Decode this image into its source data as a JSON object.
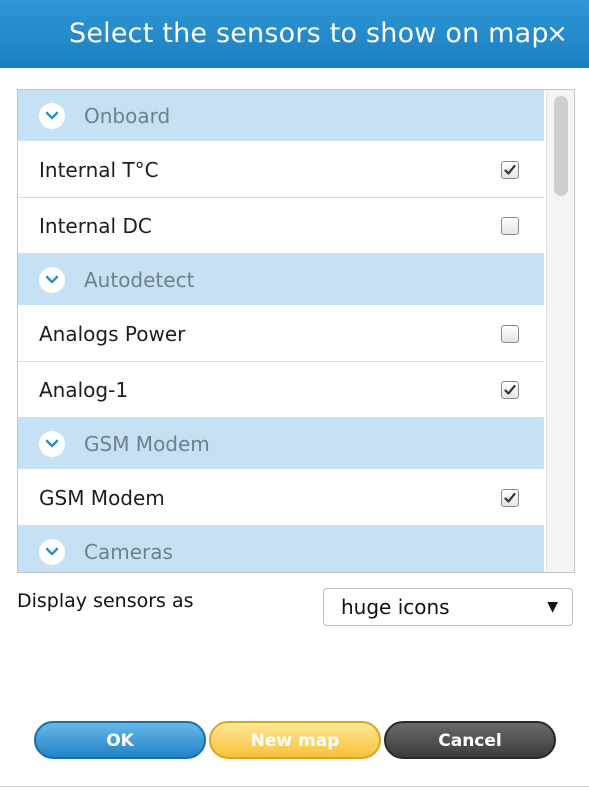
{
  "dialog": {
    "title": "Select the sensors to show on map",
    "close_glyph": "×"
  },
  "colors": {
    "header": "#1f87c9",
    "group_row": "#c6e1f3",
    "ok_button": "#2a8bcf",
    "new_map_button": "#f7c23a",
    "cancel_button": "#444444"
  },
  "list": {
    "groups": [
      {
        "label": "Onboard",
        "icon": "chevron-down-circle-icon",
        "items": [
          {
            "label": "Internal T°C",
            "checked": true
          },
          {
            "label": "Internal DC",
            "checked": false
          }
        ]
      },
      {
        "label": "Autodetect",
        "icon": "chevron-down-circle-icon",
        "items": [
          {
            "label": "Analogs Power",
            "checked": false
          },
          {
            "label": "Analog-1",
            "checked": true
          }
        ]
      },
      {
        "label": "GSM Modem",
        "icon": "chevron-down-circle-icon",
        "items": [
          {
            "label": "GSM Modem",
            "checked": true
          }
        ]
      },
      {
        "label": "Cameras",
        "icon": "chevron-down-circle-icon",
        "items": []
      }
    ]
  },
  "display": {
    "label": "Display sensors as",
    "selected": "huge icons",
    "arrow": "▼"
  },
  "buttons": {
    "ok": "OK",
    "new_map": "New map",
    "cancel": "Cancel"
  }
}
